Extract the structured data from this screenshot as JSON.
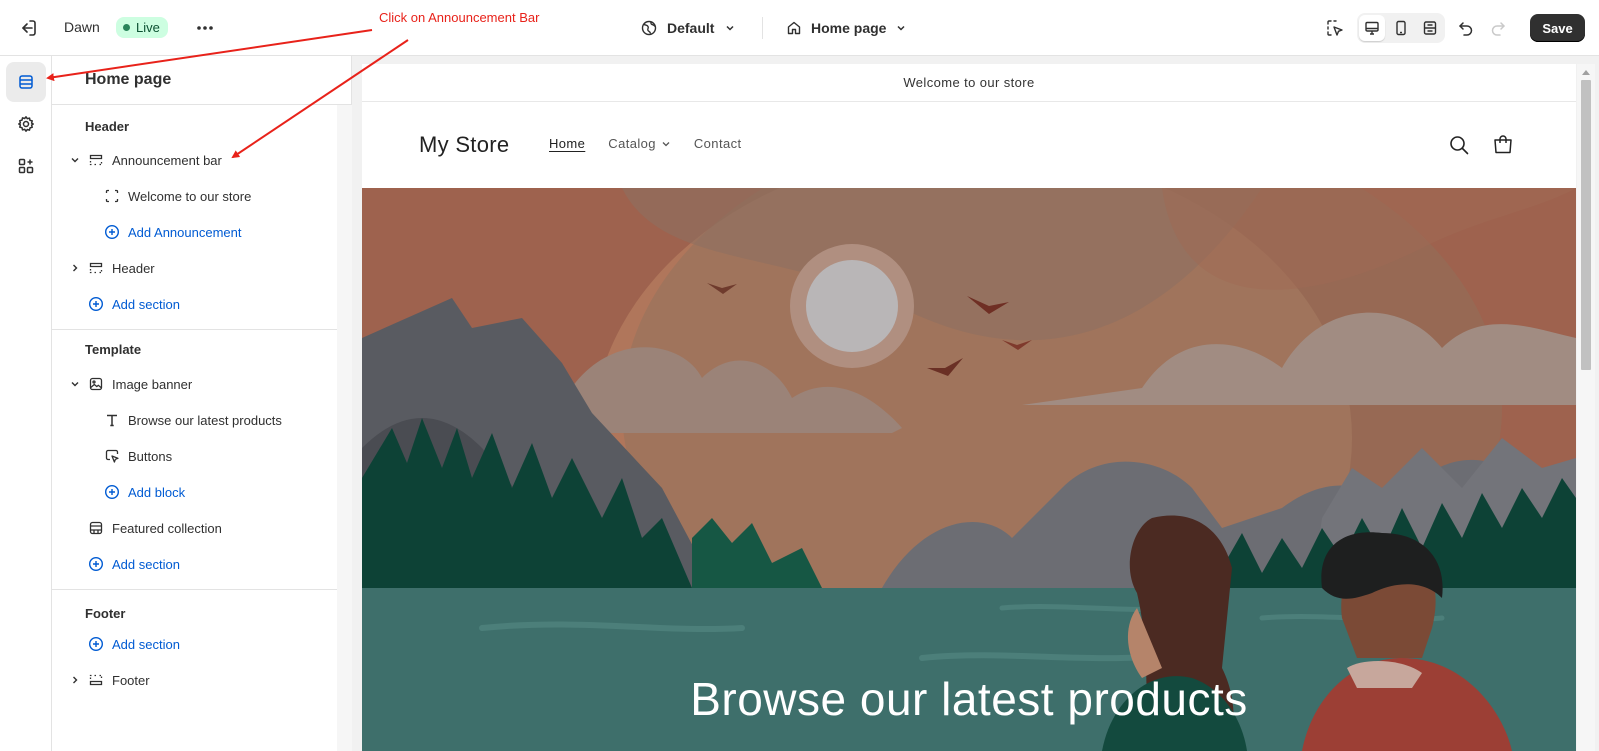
{
  "topbar": {
    "theme_name": "Dawn",
    "live_label": "Live",
    "preset_label": "Default",
    "page_label": "Home page",
    "save_label": "Save"
  },
  "sidebar": {
    "title": "Home page",
    "groups": {
      "header": {
        "heading": "Header",
        "announcement_bar": "Announcement bar",
        "announcement_block": "Welcome to our store",
        "add_announcement": "Add Announcement",
        "header_section": "Header",
        "add_section": "Add section"
      },
      "template": {
        "heading": "Template",
        "image_banner": "Image banner",
        "heading_block": "Browse our latest products",
        "buttons_block": "Buttons",
        "add_block": "Add block",
        "featured_collection": "Featured collection",
        "add_section": "Add section"
      },
      "footer": {
        "heading": "Footer",
        "add_section": "Add section",
        "footer_section": "Footer"
      }
    }
  },
  "preview": {
    "announcement": "Welcome to our store",
    "store_name": "My Store",
    "nav": {
      "home": "Home",
      "catalog": "Catalog",
      "contact": "Contact"
    },
    "banner_heading": "Browse our latest products"
  },
  "annotation": {
    "text": "Click on Announcement Bar",
    "color": "#e8221a"
  },
  "colors": {
    "accent_link": "#005bd3",
    "live_badge_bg": "#cdfee1",
    "save_button_bg": "#303030"
  }
}
